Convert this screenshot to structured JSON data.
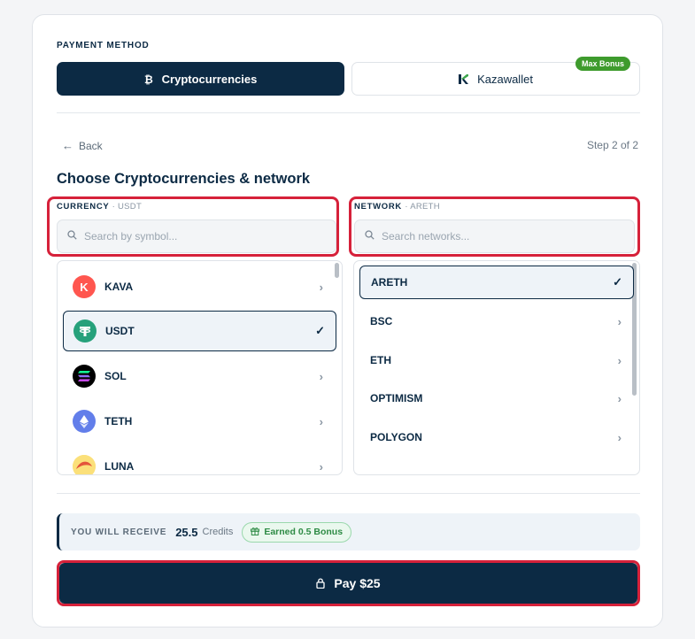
{
  "payment_method": {
    "label": "PAYMENT METHOD",
    "tabs": [
      {
        "label": "Cryptocurrencies",
        "icon": "bitcoin-icon",
        "active": true
      },
      {
        "label": "Kazawallet",
        "icon": "kazawallet-logo-icon",
        "badge": "Max Bonus",
        "active": false
      }
    ]
  },
  "nav": {
    "back_label": "Back",
    "step_label": "Step 2 of 2"
  },
  "title": "Choose Cryptocurrencies & network",
  "currency": {
    "label": "CURRENCY",
    "selected": "· USDT",
    "search_placeholder": "Search by symbol...",
    "items": [
      {
        "symbol": "KAVA",
        "icon": "kava-icon",
        "color": "#ff564f",
        "selected": false
      },
      {
        "symbol": "USDT",
        "icon": "tether-icon",
        "color": "#26a17b",
        "selected": true
      },
      {
        "symbol": "SOL",
        "icon": "solana-icon",
        "color": "#000000",
        "selected": false
      },
      {
        "symbol": "TETH",
        "icon": "ethereum-icon",
        "color": "#627eea",
        "selected": false
      },
      {
        "symbol": "LUNA",
        "icon": "luna-icon",
        "color": "#f9d85e",
        "selected": false
      }
    ]
  },
  "network": {
    "label": "NETWORK",
    "selected": "· ARETH",
    "search_placeholder": "Search networks...",
    "items": [
      {
        "name": "ARETH",
        "selected": true
      },
      {
        "name": "BSC",
        "selected": false
      },
      {
        "name": "ETH",
        "selected": false
      },
      {
        "name": "OPTIMISM",
        "selected": false
      },
      {
        "name": "POLYGON",
        "selected": false
      }
    ]
  },
  "receive": {
    "label": "YOU WILL RECEIVE",
    "amount": "25.5",
    "unit": "Credits",
    "bonus": "Earned 0.5 Bonus"
  },
  "pay_button": {
    "label": "Pay $25"
  },
  "colors": {
    "primary": "#0c2a44",
    "highlight": "#d6213a",
    "bonus_green": "#2e8b45",
    "badge_green": "#3e9b2d"
  }
}
